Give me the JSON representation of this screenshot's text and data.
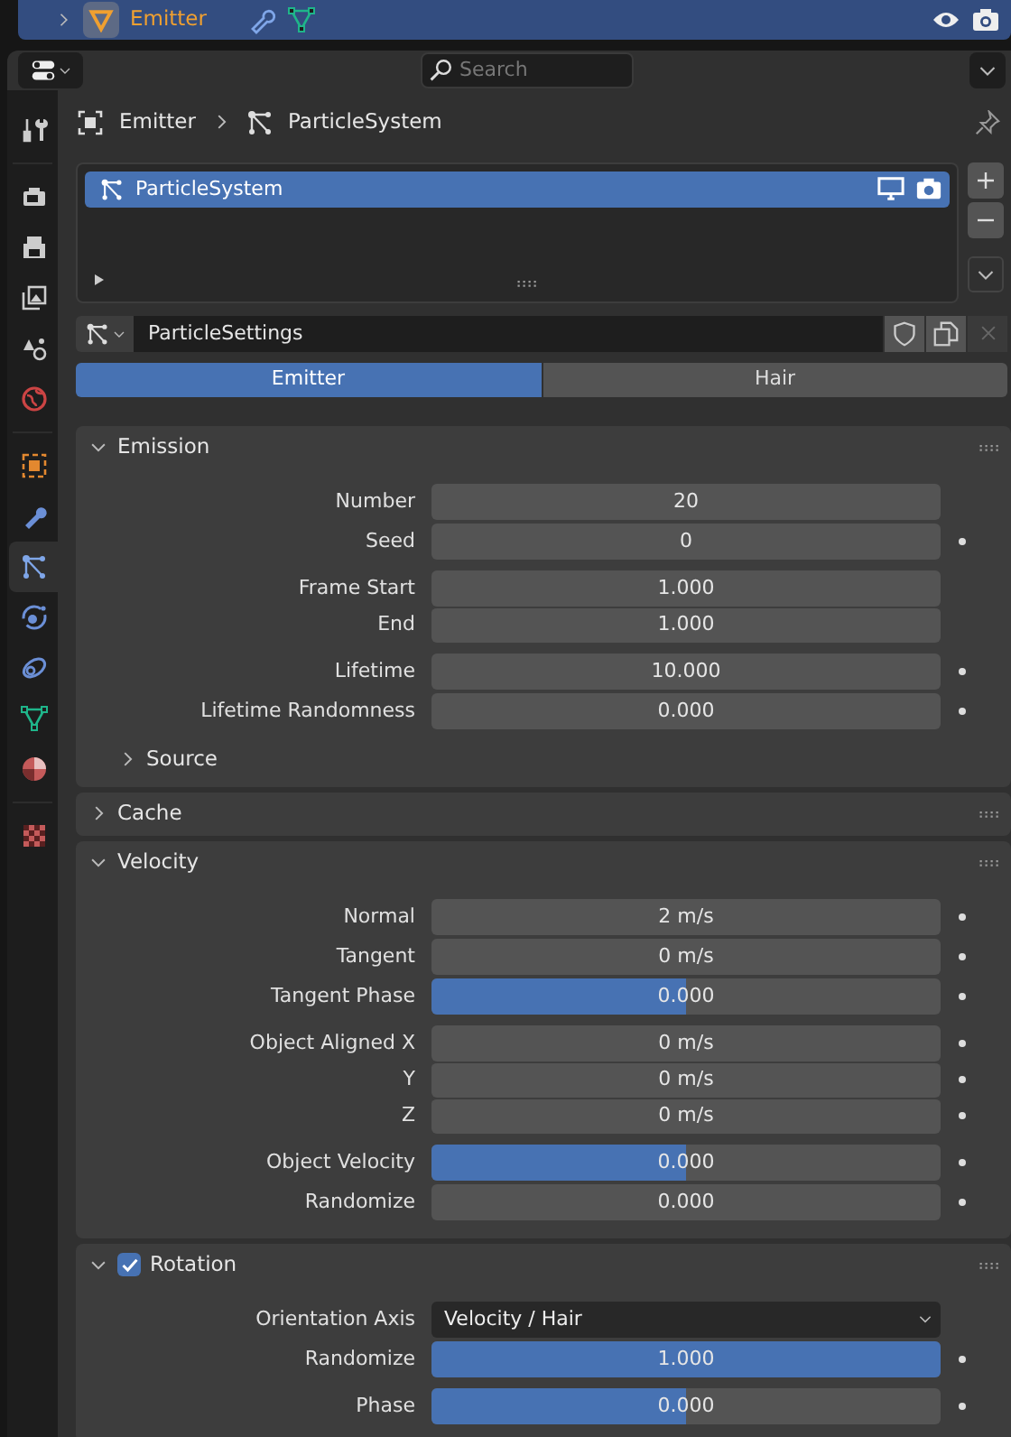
{
  "outliner_row": {
    "name": "Emitter",
    "selected": true
  },
  "header": {
    "search": {
      "placeholder": "Search"
    }
  },
  "sidebar": {
    "tab_groups": [
      [
        {
          "kind": "tool",
          "selected": false
        }
      ],
      [
        {
          "kind": "render",
          "selected": false
        },
        {
          "kind": "output",
          "selected": false
        },
        {
          "kind": "view-layer",
          "selected": false
        },
        {
          "kind": "scene",
          "selected": false
        },
        {
          "kind": "world",
          "selected": false
        }
      ],
      [
        {
          "kind": "object",
          "selected": false
        },
        {
          "kind": "modifier",
          "selected": false
        },
        {
          "kind": "particles",
          "selected": true
        },
        {
          "kind": "physics",
          "selected": false
        },
        {
          "kind": "constraints",
          "selected": false
        },
        {
          "kind": "data",
          "selected": false
        },
        {
          "kind": "material",
          "selected": false
        }
      ],
      [
        {
          "kind": "texture",
          "selected": false
        }
      ]
    ]
  },
  "breadcrumb": [
    {
      "kind": "object",
      "label": "Emitter"
    },
    {
      "kind": "particles",
      "label": "ParticleSystem"
    }
  ],
  "particle_systems": [
    {
      "label": "ParticleSystem",
      "selected": true
    }
  ],
  "settings": {
    "name": "ParticleSettings"
  },
  "type_tabs": [
    {
      "label": "Emitter",
      "selected": true
    },
    {
      "label": "Hair",
      "selected": false
    }
  ],
  "panels": [
    {
      "title": "Emission",
      "expanded": true,
      "checkbox": false,
      "groups": [
        {
          "joined": false,
          "rows": [
            {
              "label": "Number",
              "kind": "number",
              "value": "20",
              "keyframe": false
            },
            {
              "label": "Seed",
              "kind": "number",
              "value": "0",
              "keyframe": true
            }
          ]
        },
        {
          "joined": true,
          "rows": [
            {
              "label": "Frame Start",
              "kind": "number",
              "value": "1.000",
              "keyframe": false
            },
            {
              "label": "End",
              "kind": "number",
              "value": "1.000",
              "keyframe": false
            }
          ]
        },
        {
          "joined": false,
          "rows": [
            {
              "label": "Lifetime",
              "kind": "number",
              "value": "10.000",
              "keyframe": true
            },
            {
              "label": "Lifetime Randomness",
              "kind": "number",
              "value": "0.000",
              "keyframe": true
            }
          ]
        }
      ],
      "subpanels": [
        {
          "title": "Source",
          "expanded": false
        }
      ]
    },
    {
      "title": "Cache",
      "expanded": false,
      "checkbox": false
    },
    {
      "title": "Velocity",
      "expanded": true,
      "checkbox": false,
      "groups": [
        {
          "joined": false,
          "rows": [
            {
              "label": "Normal",
              "kind": "number",
              "value": "2 m/s",
              "keyframe": true
            },
            {
              "label": "Tangent",
              "kind": "number",
              "value": "0 m/s",
              "keyframe": true
            },
            {
              "label": "Tangent Phase",
              "kind": "slider",
              "value": "0.000",
              "level": 0.5,
              "keyframe": true
            }
          ]
        },
        {
          "joined": true,
          "rows": [
            {
              "label": "Object Aligned X",
              "kind": "number",
              "value": "0 m/s",
              "keyframe": true
            },
            {
              "label": "Y",
              "kind": "number",
              "value": "0 m/s",
              "keyframe": true
            },
            {
              "label": "Z",
              "kind": "number",
              "value": "0 m/s",
              "keyframe": true
            }
          ]
        },
        {
          "joined": false,
          "rows": [
            {
              "label": "Object Velocity",
              "kind": "slider",
              "value": "0.000",
              "level": 0.5,
              "keyframe": true
            },
            {
              "label": "Randomize",
              "kind": "number",
              "value": "0.000",
              "keyframe": true
            }
          ]
        }
      ]
    },
    {
      "title": "Rotation",
      "expanded": true,
      "checkbox": true,
      "checked": true,
      "groups": [
        {
          "joined": false,
          "rows": [
            {
              "label": "Orientation Axis",
              "kind": "dropdown",
              "value": "Velocity / Hair",
              "keyframe": false
            },
            {
              "label": "Randomize",
              "kind": "slider",
              "value": "1.000",
              "level": 1,
              "keyframe": true
            }
          ]
        },
        {
          "joined": false,
          "rows": [
            {
              "label": "Phase",
              "kind": "slider",
              "value": "0.000",
              "level": 0.5,
              "keyframe": true
            }
          ]
        }
      ]
    }
  ]
}
